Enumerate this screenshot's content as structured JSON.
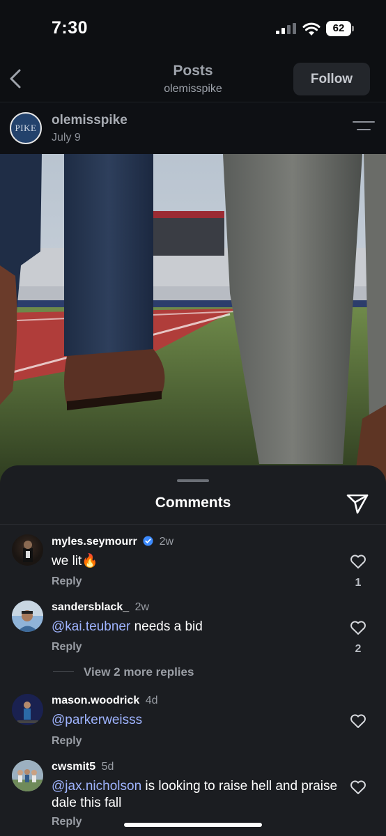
{
  "status_bar": {
    "time": "7:30",
    "battery": "62"
  },
  "top_nav": {
    "title": "Posts",
    "subtitle": "olemisspike",
    "follow_label": "Follow"
  },
  "post": {
    "avatar_text": "PIKE",
    "username": "olemisspike",
    "date": "July 9"
  },
  "comments_sheet": {
    "title": "Comments",
    "comments": [
      {
        "username": "myles.seymourr",
        "verified": true,
        "time": "2w",
        "text": "we lit🔥",
        "reply_label": "Reply",
        "likes": "1"
      },
      {
        "username": "sandersblack_",
        "time": "2w",
        "mention": "@kai.teubner",
        "text": " needs a bid",
        "reply_label": "Reply",
        "likes": "2",
        "more_replies": "View 2 more replies"
      },
      {
        "username": "mason.woodrick",
        "time": "4d",
        "mention": "@parkerweisss",
        "text": "",
        "reply_label": "Reply"
      },
      {
        "username": "cwsmit5",
        "time": "5d",
        "mention": "@jax.nicholson",
        "text": " is looking to raise hell and praise dale this fall",
        "reply_label": "Reply"
      }
    ]
  },
  "icons": [
    "back-chevron-icon",
    "menu-icon",
    "share-icon",
    "heart-icon",
    "verified-icon",
    "signal-icon",
    "wifi-icon",
    "battery-icon"
  ],
  "colors": {
    "background": "#0d0f12",
    "sheet": "#1b1d21",
    "mention": "#9fb4ff",
    "verified": "#3d8bff"
  }
}
